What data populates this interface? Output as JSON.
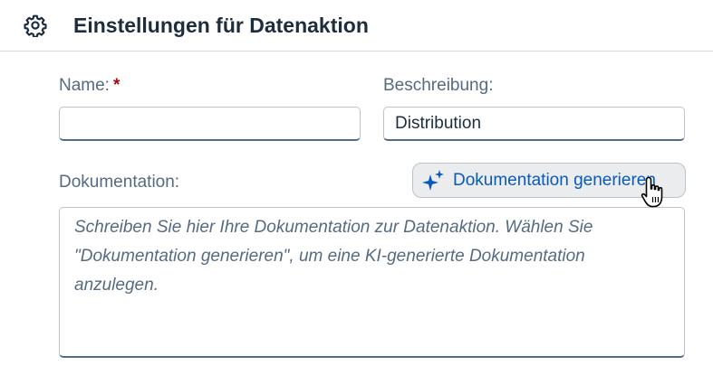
{
  "header": {
    "title": "Einstellungen für Datenaktion",
    "icon": "gear-icon"
  },
  "form": {
    "name": {
      "label": "Name:",
      "required_marker": "*",
      "value": ""
    },
    "description": {
      "label": "Beschreibung:",
      "value": "Distribution"
    },
    "documentation": {
      "label": "Dokumentation:",
      "placeholder": "Schreiben Sie hier Ihre Dokumentation zur Datenaktion. Wählen Sie \"Dokumentation generieren\", um eine KI-generierte Dokumentation anzulegen.",
      "value": ""
    },
    "generate_button": {
      "label": "Dokumentation generieren",
      "icon": "sparkle-icon"
    }
  },
  "colors": {
    "text": "#1d2d3e",
    "label": "#556b82",
    "required": "#aa0808",
    "accent": "#0a5bb8",
    "button_bg": "#eaecee",
    "border": "#bcc3ca"
  }
}
